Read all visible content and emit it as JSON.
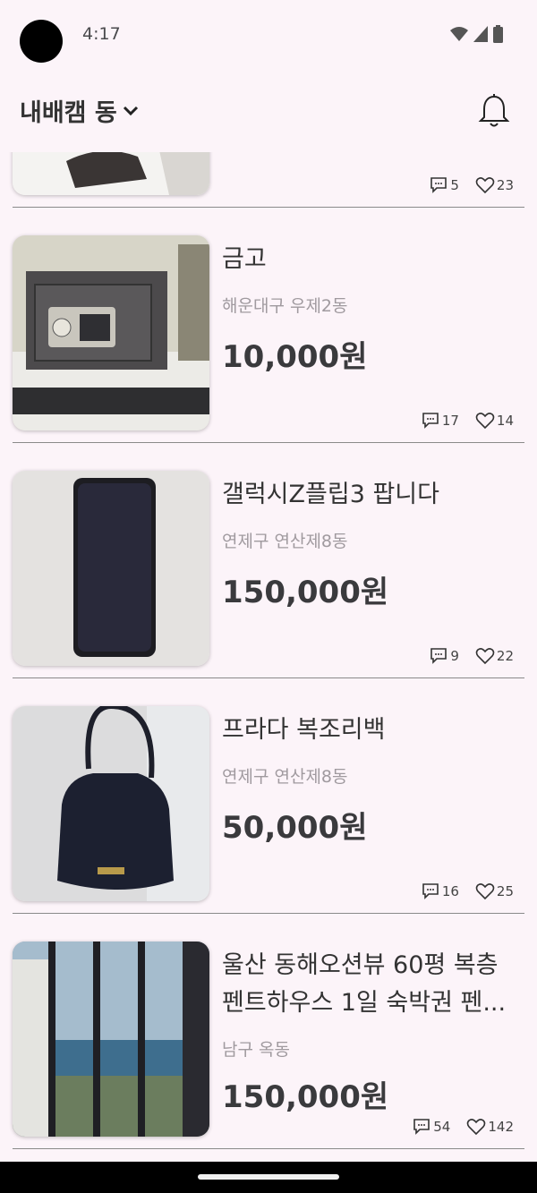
{
  "status_bar": {
    "time": "4:17"
  },
  "header": {
    "location": "내배캠 동"
  },
  "items": [
    {
      "title": "",
      "location": "",
      "price": "",
      "comments": "5",
      "likes": "23"
    },
    {
      "title": "금고",
      "location": "해운대구 우제2동",
      "price": "10,000원",
      "comments": "17",
      "likes": "14"
    },
    {
      "title": "갤럭시Z플립3 팝니다",
      "location": "연제구 연산제8동",
      "price": "150,000원",
      "comments": "9",
      "likes": "22"
    },
    {
      "title": "프라다 복조리백",
      "location": "연제구 연산제8동",
      "price": "50,000원",
      "comments": "16",
      "likes": "25"
    },
    {
      "title": "울산 동해오션뷰 60평 복층 펜트하우스 1일 숙박권 펜...",
      "location": "남구 옥동",
      "price": "150,000원",
      "comments": "54",
      "likes": "142"
    }
  ]
}
